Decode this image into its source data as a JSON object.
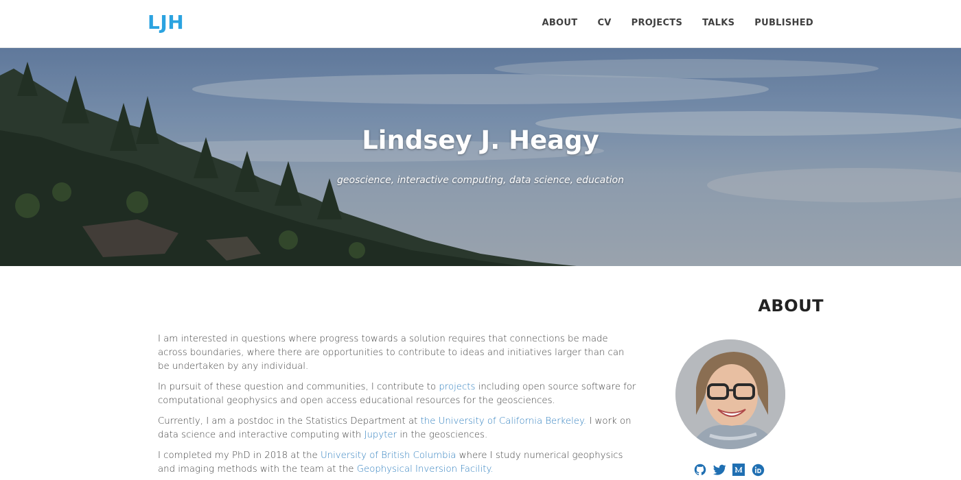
{
  "brand": {
    "logo_text": "LJH",
    "accent": "#2ba3e0"
  },
  "nav": {
    "items": [
      {
        "label": "ABOUT"
      },
      {
        "label": "CV"
      },
      {
        "label": "PROJECTS"
      },
      {
        "label": "TALKS"
      },
      {
        "label": "PUBLISHED"
      }
    ]
  },
  "hero": {
    "title": "Lindsey J. Heagy",
    "subtitle": "geoscience, interactive computing, data science, education"
  },
  "about": {
    "heading": "ABOUT",
    "p1": "I am interested in questions where progress towards a solution requires that connections be made across boundaries, where there are opportunities to contribute to ideas and initiatives larger than can be undertaken by any individual.",
    "p2_before": "In pursuit of these question and communities, I contribute to ",
    "p2_link": "projects",
    "p2_after": " including open source software for computational geophysics and open access educational resources for the geosciences.",
    "p3_before": "Currently, I am a postdoc in the Statistics Department at ",
    "p3_link": "the University of California Berkeley.",
    "p3_middle": " I work on data science and interactive computing with ",
    "p3_link2": "Jupyter",
    "p3_after": " in the geosciences.",
    "p4_before": "I completed my PhD in 2018 at the ",
    "p4_link": "University of British Columbia",
    "p4_middle": " where I study numerical geophysics and imaging methods with the team at the ",
    "p4_link2": "Geophysical Inversion Facility."
  },
  "socials": [
    {
      "icon": "github-icon"
    },
    {
      "icon": "twitter-icon"
    },
    {
      "icon": "medium-icon"
    },
    {
      "icon": "orcid-icon"
    }
  ],
  "colors": {
    "link": "#2f7fbf",
    "text": "#404040",
    "icon": "#1f6fb2"
  }
}
